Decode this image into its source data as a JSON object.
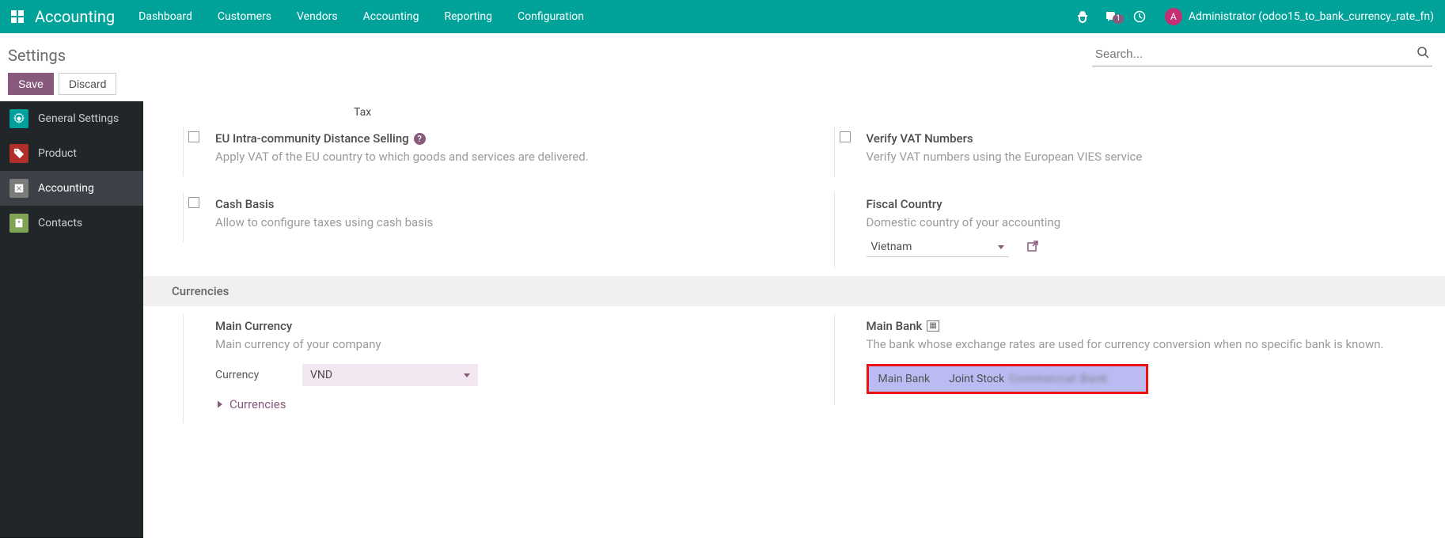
{
  "topnav": {
    "app_title": "Accounting",
    "items": [
      "Dashboard",
      "Customers",
      "Vendors",
      "Accounting",
      "Reporting",
      "Configuration"
    ],
    "msg_badge": "1",
    "user_initial": "A",
    "user_label": "Administrator (odoo15_to_bank_currency_rate_fn)"
  },
  "cp": {
    "breadcrumb": "Settings",
    "save": "Save",
    "discard": "Discard",
    "search_placeholder": "Search..."
  },
  "sidebar": {
    "items": [
      {
        "label": "General Settings"
      },
      {
        "label": "Product"
      },
      {
        "label": "Accounting"
      },
      {
        "label": "Contacts"
      }
    ]
  },
  "settings": {
    "tax_label": "Tax",
    "eu": {
      "title": "EU Intra-community Distance Selling",
      "desc": "Apply VAT of the EU country to which goods and services are delivered."
    },
    "vat": {
      "title": "Verify VAT Numbers",
      "desc": "Verify VAT numbers using the European VIES service"
    },
    "cash": {
      "title": "Cash Basis",
      "desc": "Allow to configure taxes using cash basis"
    },
    "fiscal": {
      "title": "Fiscal Country",
      "desc": "Domestic country of your accounting",
      "value": "Vietnam"
    },
    "section_currencies": "Currencies",
    "main_currency": {
      "title": "Main Currency",
      "desc": "Main currency of your company",
      "field_label": "Currency",
      "value": "VND",
      "link": "Currencies"
    },
    "main_bank": {
      "title": "Main Bank",
      "desc": "The bank whose exchange rates are used for currency conversion when no specific bank is known.",
      "field_label": "Main Bank",
      "value_prefix": "Joint Stock",
      "value_hidden": "Commercial Bank"
    }
  }
}
